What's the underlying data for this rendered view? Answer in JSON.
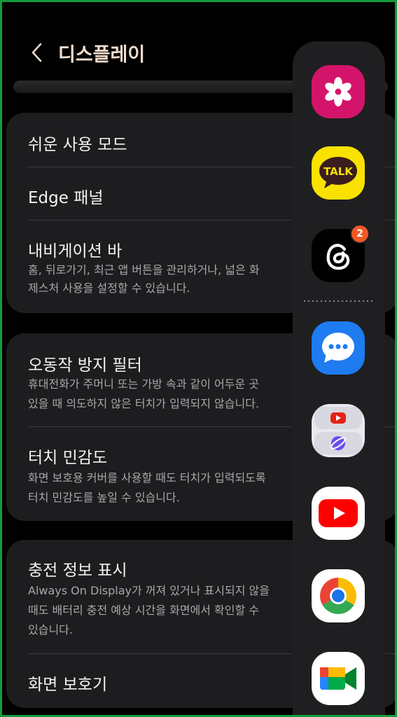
{
  "header": {
    "title": "디스플레이",
    "back_icon": "chevron-left-icon"
  },
  "cards": [
    {
      "items": [
        {
          "title": "쉬운 사용 모드"
        },
        {
          "title": "Edge 패널"
        },
        {
          "title": "내비게이션 바",
          "desc": [
            "홈, 뒤로가기, 최근 앱 버튼을 관리하거나, 넓은 화",
            "제스처 사용을 설정할 수 있습니다."
          ]
        }
      ]
    },
    {
      "items": [
        {
          "title": "오동작 방지 필터",
          "desc": [
            "휴대전화가 주머니 또는 가방 속과 같이 어두운 곳",
            "있을 때 의도하지 않은 터치가 입력되지 않습니다."
          ]
        },
        {
          "title": "터치 민감도",
          "desc": [
            "화면 보호용 커버를 사용할 때도 터치가 입력되도록",
            "터치 민감도를 높일 수 있습니다."
          ]
        }
      ]
    },
    {
      "items": [
        {
          "title": "충전 정보 표시",
          "desc": [
            "Always On Display가 꺼져 있거나 표시되지 않을",
            "때도 배터리 충전 예상 시간을 화면에서 확인할 수",
            "있습니다."
          ]
        },
        {
          "title": "화면 보호기"
        }
      ]
    }
  ],
  "edge_panel": {
    "apps": [
      {
        "name": "gallery",
        "icon": "flower-icon",
        "color": "#d4146b"
      },
      {
        "name": "kakaotalk",
        "icon": "talk-bubble-icon",
        "label": "TALK",
        "color": "#fae100"
      },
      {
        "name": "threads",
        "icon": "threads-icon",
        "badge": "2",
        "color": "#000000"
      },
      {
        "name": "messages",
        "icon": "chat-bubble-icon",
        "color": "#1f7bf0"
      },
      {
        "name": "app-pair",
        "icon": "app-pair-icon",
        "color": "#e8e8ee"
      },
      {
        "name": "youtube",
        "icon": "youtube-icon",
        "color": "#ffffff"
      },
      {
        "name": "chrome",
        "icon": "chrome-icon",
        "color": "#ffffff"
      },
      {
        "name": "google-meet",
        "icon": "meet-icon",
        "color": "#ffffff"
      }
    ]
  }
}
